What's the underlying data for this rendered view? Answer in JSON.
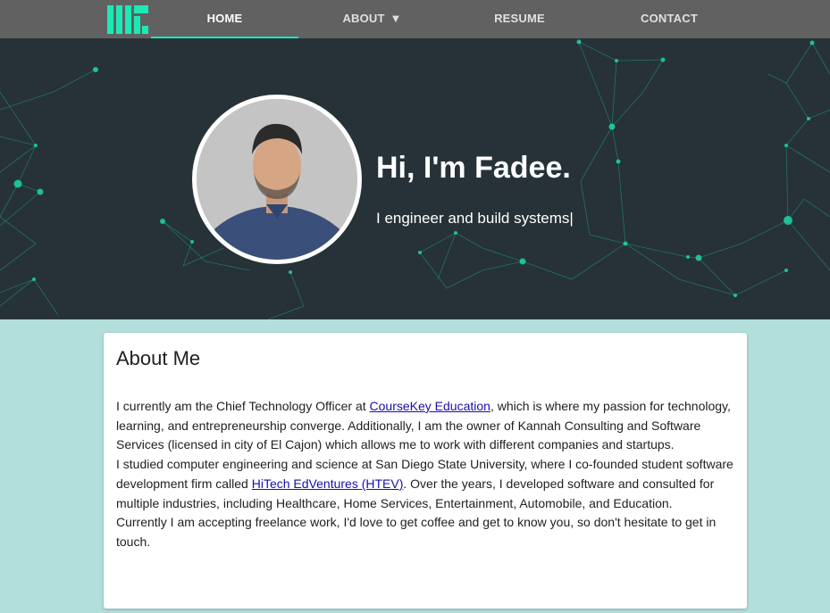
{
  "nav": {
    "items": [
      {
        "label": "HOME"
      },
      {
        "label": "ABOUT",
        "caret": "▼"
      },
      {
        "label": "RESUME"
      },
      {
        "label": "CONTACT"
      }
    ],
    "accent_color": "#1de9b6"
  },
  "hero": {
    "title": "Hi, I'm Fadee.",
    "subtitle": "I engineer and build systems|"
  },
  "about": {
    "heading": "About Me",
    "p1_a": "I currently am the Chief Technology Officer at ",
    "p1_link": "CourseKey Education",
    "p1_b": ", which is where my passion for technology, learning, and entrepreneurship converge. Additionally, I am the owner of Kannah Consulting and Software Services (licensed in city of El Cajon) which allows me to work with different companies and startups.",
    "p2_a": "I studied computer engineering and science at San Diego State University, where I co-founded student software development firm called ",
    "p2_link": "HiTech EdVentures (HTEV)",
    "p2_b": ". Over the years, I developed software and consulted for multiple industries, including Healthcare, Home Services, Entertainment, Automobile, and Education.",
    "p3": "Currently I am accepting freelance work, I'd love to get coffee and get to know you, so don't hesitate to get in touch."
  }
}
